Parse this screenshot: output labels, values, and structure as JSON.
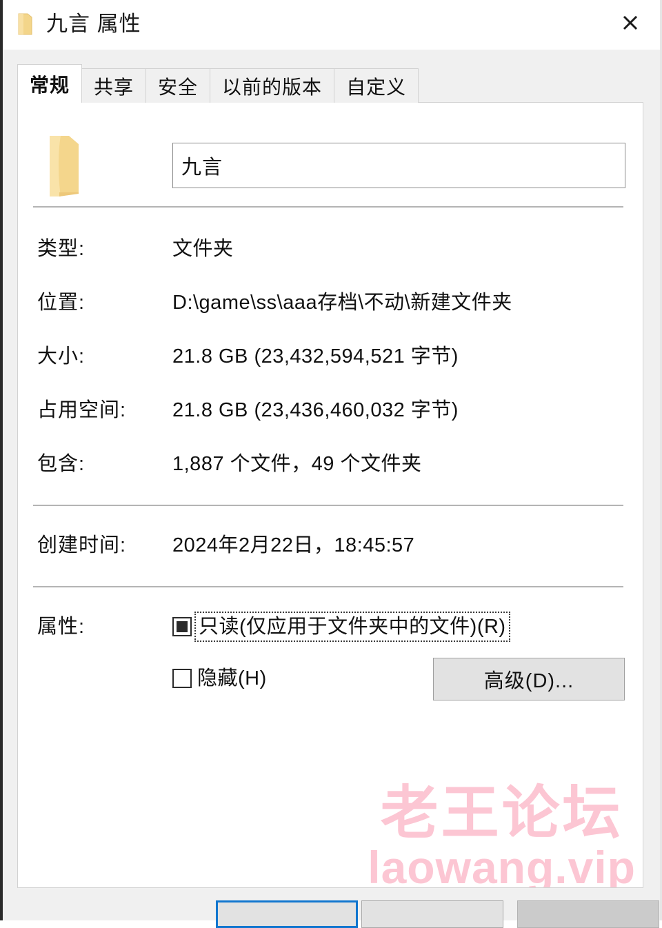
{
  "window": {
    "title": "九言 属性",
    "icon": "folder-icon",
    "close_label": "✕"
  },
  "tabs": [
    {
      "label": "常规",
      "active": true
    },
    {
      "label": "共享",
      "active": false
    },
    {
      "label": "安全",
      "active": false
    },
    {
      "label": "以前的版本",
      "active": false
    },
    {
      "label": "自定义",
      "active": false
    }
  ],
  "general": {
    "folder_icon": "folder-icon",
    "name_value": "九言",
    "name_placeholder": "",
    "rows": [
      {
        "label": "类型:",
        "value": "文件夹"
      },
      {
        "label": "位置:",
        "value": "D:\\game\\ss\\aaa存档\\不动\\新建文件夹"
      },
      {
        "label": "大小:",
        "value": "21.8 GB (23,432,594,521 字节)"
      },
      {
        "label": "占用空间:",
        "value": "21.8 GB (23,436,460,032 字节)"
      },
      {
        "label": "包含:",
        "value": "1,887 个文件，49 个文件夹"
      }
    ],
    "created": {
      "label": "创建时间:",
      "value": "2024年2月22日，18:45:57"
    },
    "attributes": {
      "label": "属性:",
      "readonly": {
        "text": "只读(仅应用于文件夹中的文件)(R)",
        "state": "indeterminate",
        "focused": true
      },
      "hidden": {
        "text": "隐藏(H)",
        "state": "unchecked",
        "focused": false
      },
      "advanced_button": "高级(D)..."
    }
  },
  "watermark": {
    "line1": "老王论坛",
    "line2": "laowang.vip",
    "color": "#fcc6d3"
  },
  "footer": {
    "ok": "",
    "cancel": "",
    "apply": ""
  },
  "colors": {
    "accent": "#1176cf",
    "dialog_bg": "#f0f0f0",
    "panel_bg": "#ffffff",
    "folder": "#f5d98b"
  }
}
